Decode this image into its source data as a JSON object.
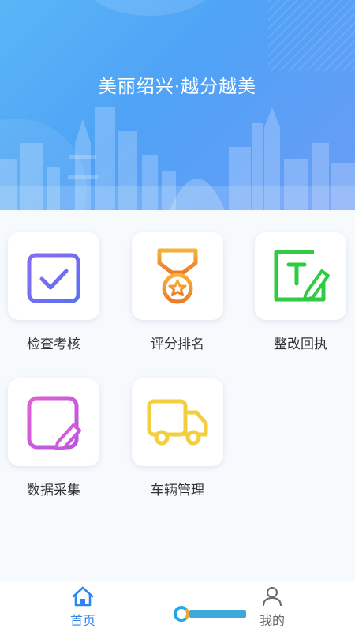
{
  "banner": {
    "slogan": "美丽绍兴·越分越美",
    "gradient_start": "#5ab6f7",
    "gradient_end": "#6b9cf6"
  },
  "menu": {
    "items": [
      {
        "label": "检查考核",
        "icon": "calendar-check-icon",
        "color": "#7b6cf0"
      },
      {
        "label": "评分排名",
        "icon": "medal-star-icon",
        "color": "#f08a2c"
      },
      {
        "label": "整改回执",
        "icon": "text-edit-icon",
        "color": "#2ecc40"
      },
      {
        "label": "数据采集",
        "icon": "document-pencil-icon",
        "color": "#d05ad8"
      },
      {
        "label": "车辆管理",
        "icon": "truck-icon",
        "color": "#f2cf3e"
      }
    ]
  },
  "tabbar": {
    "home_label": "首页",
    "mine_label": "我的",
    "active_color": "#2f86f0",
    "inactive_color": "#6b6b6b"
  }
}
